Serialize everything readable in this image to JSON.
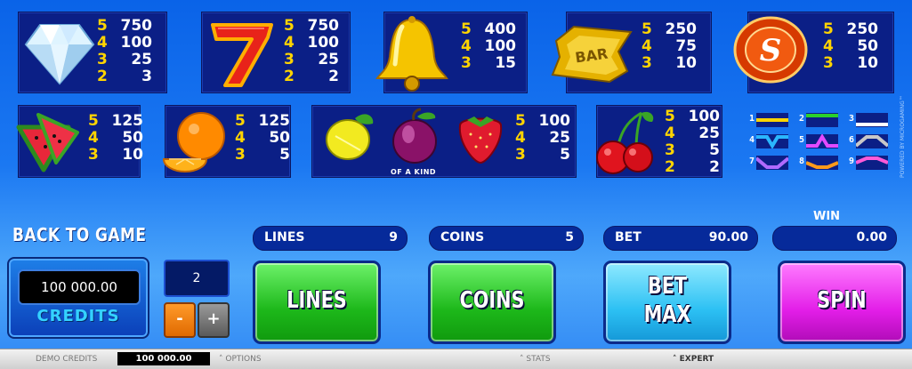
{
  "paytable": {
    "diamond": {
      "pays": [
        {
          "count": "5",
          "value": "750"
        },
        {
          "count": "4",
          "value": "100"
        },
        {
          "count": "3",
          "value": "25"
        },
        {
          "count": "2",
          "value": "3"
        }
      ]
    },
    "seven": {
      "pays": [
        {
          "count": "5",
          "value": "750"
        },
        {
          "count": "4",
          "value": "100"
        },
        {
          "count": "3",
          "value": "25"
        },
        {
          "count": "2",
          "value": "2"
        }
      ]
    },
    "bell": {
      "pays": [
        {
          "count": "5",
          "value": "400"
        },
        {
          "count": "4",
          "value": "100"
        },
        {
          "count": "3",
          "value": "15"
        }
      ]
    },
    "bar": {
      "label": "BAR",
      "pays": [
        {
          "count": "5",
          "value": "250"
        },
        {
          "count": "4",
          "value": "75"
        },
        {
          "count": "3",
          "value": "10"
        }
      ]
    },
    "scatter": {
      "label": "S",
      "pays": [
        {
          "count": "5",
          "value": "250"
        },
        {
          "count": "4",
          "value": "50"
        },
        {
          "count": "3",
          "value": "10"
        }
      ]
    },
    "watermelon": {
      "pays": [
        {
          "count": "5",
          "value": "125"
        },
        {
          "count": "4",
          "value": "50"
        },
        {
          "count": "3",
          "value": "10"
        }
      ]
    },
    "orange": {
      "pays": [
        {
          "count": "5",
          "value": "125"
        },
        {
          "count": "4",
          "value": "50"
        },
        {
          "count": "3",
          "value": "5"
        }
      ]
    },
    "mixed_fruit": {
      "caption": "OF A KIND",
      "pays": [
        {
          "count": "5",
          "value": "100"
        },
        {
          "count": "4",
          "value": "25"
        },
        {
          "count": "3",
          "value": "5"
        }
      ]
    },
    "cherry": {
      "pays": [
        {
          "count": "5",
          "value": "100"
        },
        {
          "count": "4",
          "value": "25"
        },
        {
          "count": "3",
          "value": "5"
        },
        {
          "count": "2",
          "value": "2"
        }
      ]
    }
  },
  "paylines": [
    "1",
    "2",
    "3",
    "4",
    "5",
    "6",
    "7",
    "8",
    "9"
  ],
  "colors": {
    "pay_count": "#ffd400",
    "pay_value": "#ffffff",
    "panel": "#0b1f86"
  },
  "back_to_game": "BACK TO GAME",
  "credits": {
    "value": "100 000.00",
    "label": "CREDITS"
  },
  "stepper": {
    "value": "2",
    "minus": "-",
    "plus": "+"
  },
  "status": {
    "lines": {
      "label": "LINES",
      "value": "9"
    },
    "coins": {
      "label": "COINS",
      "value": "5"
    },
    "bet": {
      "label": "BET",
      "value": "90.00"
    },
    "win": {
      "label": "WIN",
      "value": "0.00"
    }
  },
  "buttons": {
    "lines": "LINES",
    "coins": "COINS",
    "bet_max_1": "BET",
    "bet_max_2": "MAX",
    "spin": "SPIN"
  },
  "bottom_bar": {
    "demo_credits": "DEMO CREDITS",
    "demo_value": "100 000.00",
    "options": "OPTIONS",
    "stats": "STATS",
    "expert": "EXPERT"
  },
  "powered_by": "POWERED BY MICROGAMING™"
}
